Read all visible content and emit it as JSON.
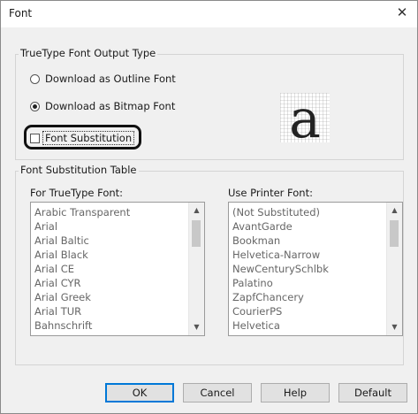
{
  "window": {
    "title": "Font",
    "close_glyph": "✕"
  },
  "output_type": {
    "label": "TrueType Font Output Type",
    "options": [
      {
        "label": "Download as Outline Font",
        "selected": false
      },
      {
        "label": "Download as Bitmap Font",
        "selected": true
      }
    ],
    "preview_glyph": "a"
  },
  "font_substitution": {
    "label": "Font Substitution",
    "checked": false
  },
  "substitution_table": {
    "label": "Font Substitution Table",
    "truetype_caption": "For TrueType Font:",
    "truetype_fonts": [
      "Arabic Transparent",
      "Arial",
      "Arial Baltic",
      "Arial Black",
      "Arial CE",
      "Arial CYR",
      "Arial Greek",
      "Arial TUR",
      "Bahnschrift"
    ],
    "printer_caption": "Use Printer Font:",
    "printer_fonts": [
      "(Not Substituted)",
      "AvantGarde",
      "Bookman",
      "Helvetica-Narrow",
      "NewCenturySchlbk",
      "Palatino",
      "ZapfChancery",
      "CourierPS",
      "Helvetica"
    ]
  },
  "buttons": {
    "ok": "OK",
    "cancel": "Cancel",
    "help": "Help",
    "default": "Default"
  }
}
